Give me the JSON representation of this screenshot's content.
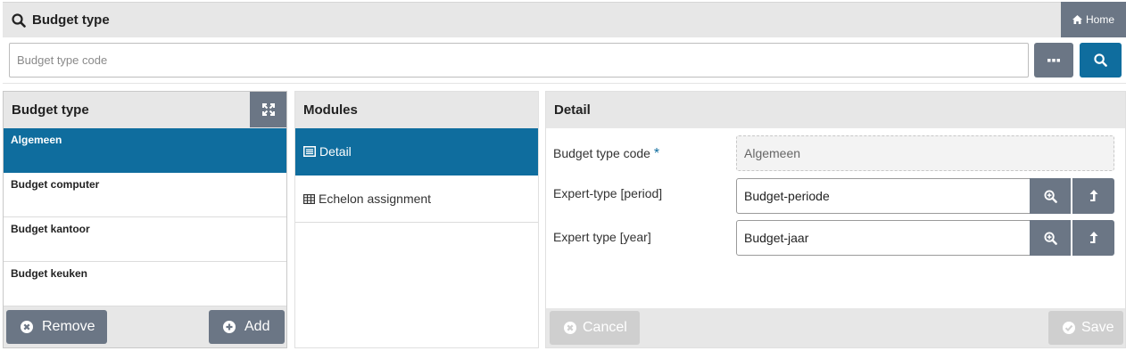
{
  "header": {
    "title": "Budget type",
    "home_label": "Home"
  },
  "search": {
    "placeholder": "Budget type code"
  },
  "list_panel": {
    "title": "Budget type",
    "items": [
      {
        "label": "Algemeen",
        "active": true
      },
      {
        "label": "Budget computer",
        "active": false
      },
      {
        "label": "Budget kantoor",
        "active": false
      },
      {
        "label": "Budget keuken",
        "active": false
      }
    ],
    "remove_label": "Remove",
    "add_label": "Add"
  },
  "modules_panel": {
    "title": "Modules",
    "items": [
      {
        "label": "Detail",
        "active": true
      },
      {
        "label": "Echelon assignment",
        "active": false
      }
    ]
  },
  "detail_panel": {
    "title": "Detail",
    "fields": {
      "code": {
        "label": "Budget type code",
        "required_mark": "*",
        "value": "Algemeen"
      },
      "period": {
        "label": "Expert-type [period]",
        "value": "Budget-periode"
      },
      "year": {
        "label": "Expert type [year]",
        "value": "Budget-jaar"
      }
    },
    "cancel_label": "Cancel",
    "save_label": "Save"
  },
  "colors": {
    "primary": "#0f6d9e",
    "secondary": "#6b7685",
    "disabled": "#cfcfcf",
    "panel_header": "#e7e7e7"
  }
}
